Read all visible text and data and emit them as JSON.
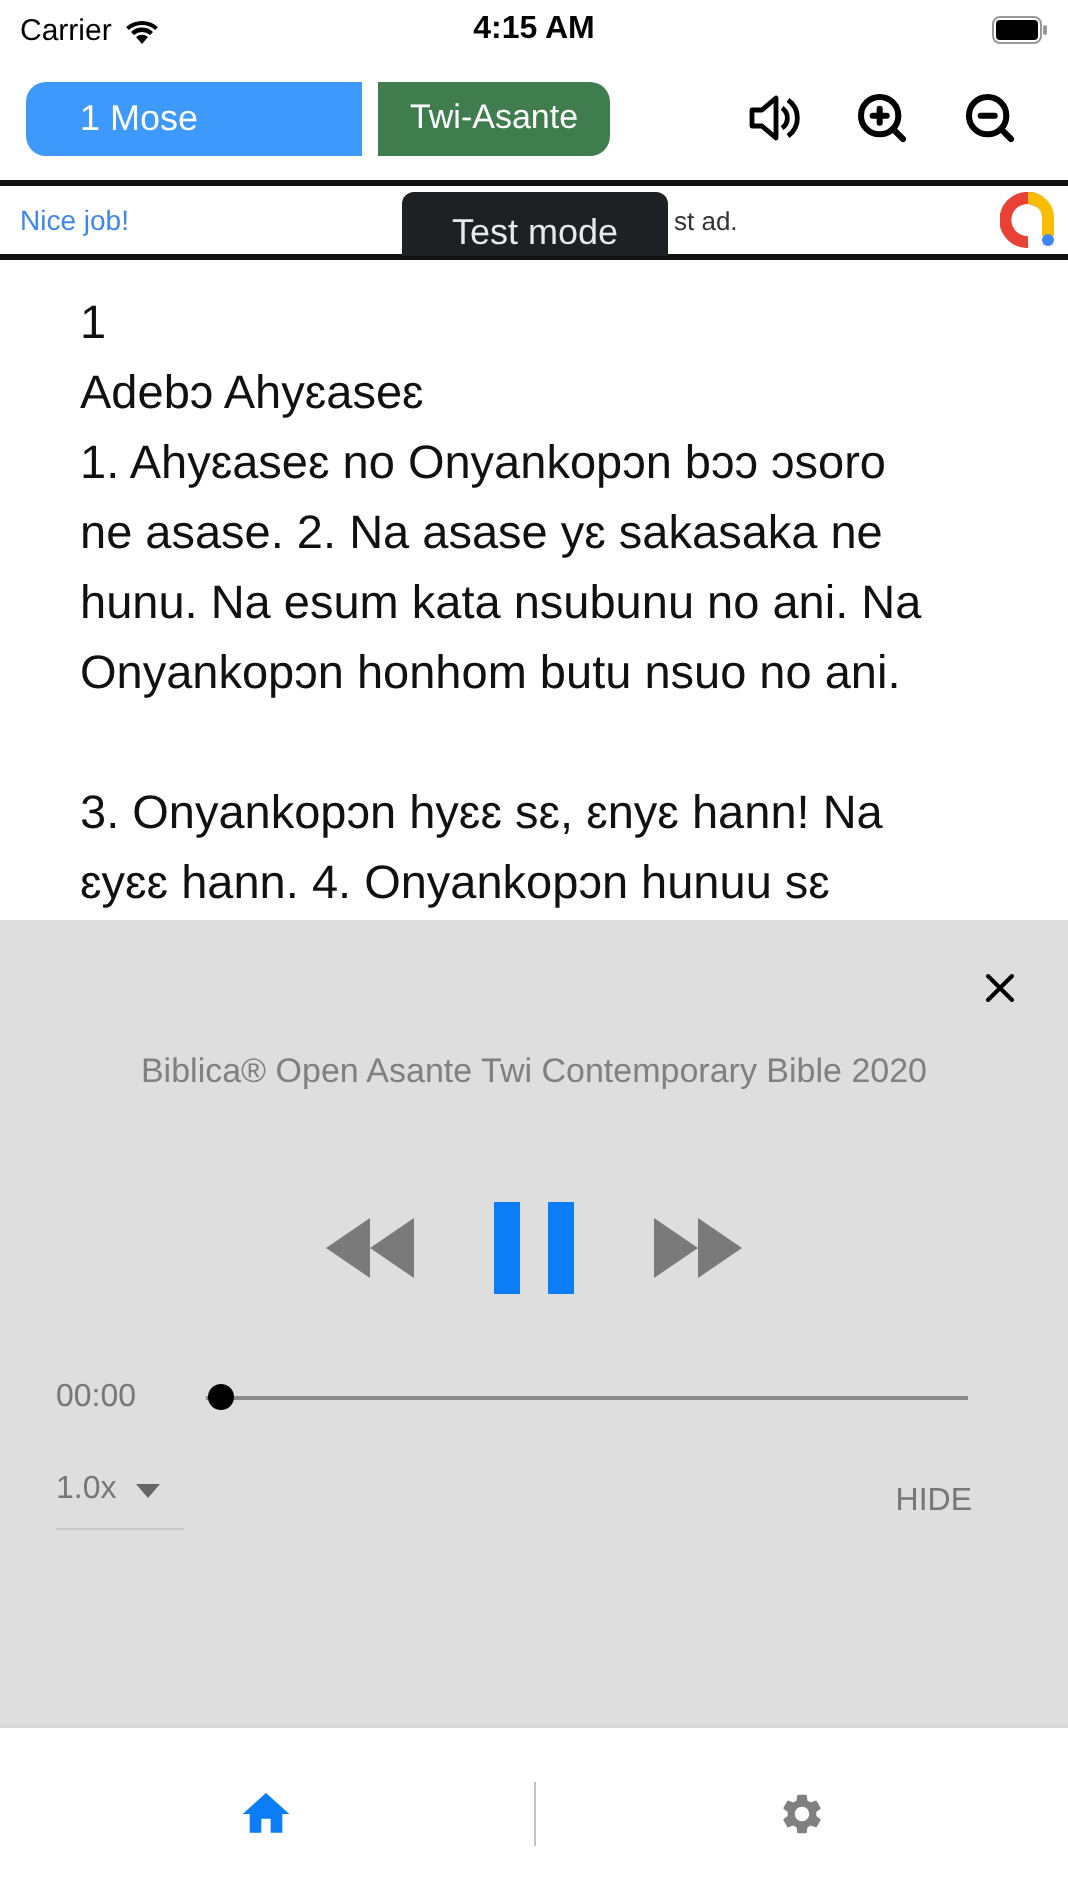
{
  "status_bar": {
    "carrier": "Carrier",
    "time": "4:15 AM"
  },
  "toolbar": {
    "book": "1 Mose",
    "language": "Twi-Asante"
  },
  "ad": {
    "headline": "Nice job!",
    "body": "st ad.",
    "badge": "Test mode"
  },
  "reader": {
    "chapter": "1",
    "heading": "Adebɔ Ahyɛaseɛ",
    "paragraphs": [
      [
        "1. Ahyɛaseɛ no Onyankopɔn bɔɔ ɔsoro",
        "ne asase. 2. Na asase yɛ sakasaka ne",
        "hunu. Na esum kata nsubunu no ani. Na",
        "Onyankopɔn honhom butu nsuo no ani."
      ],
      [
        "3. Onyankopɔn hyɛɛ sɛ, ɛnyɛ hann! Na",
        "ɛyɛɛ hann. 4. Onyankopɔn hunuu sɛ"
      ]
    ]
  },
  "player": {
    "title": "Biblica® Open Asante Twi Contemporary Bible 2020",
    "playing": true,
    "elapsed": "00:00",
    "level": 0,
    "speed": "1.0x",
    "hide": "HIDE"
  },
  "tabs": [
    {
      "kind": "home",
      "selected": true
    },
    {
      "kind": "settings",
      "selected": false
    }
  ]
}
